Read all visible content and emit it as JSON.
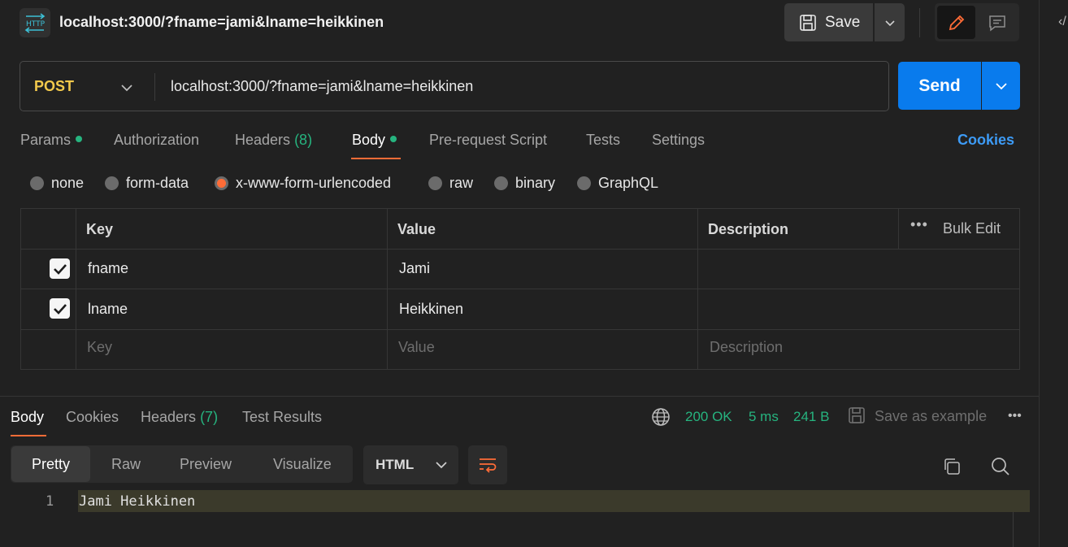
{
  "header": {
    "http_icon_label": "HTTP",
    "request_title": "localhost:3000/?fname=jami&lname=heikkinen",
    "save_label": "Save",
    "rail_glyph": "‹/"
  },
  "request": {
    "method": "POST",
    "url": "localhost:3000/?fname=jami&lname=heikkinen",
    "send_label": "Send"
  },
  "request_tabs": {
    "params": "Params",
    "authorization": "Authorization",
    "headers": "Headers",
    "headers_count": "(8)",
    "body": "Body",
    "pre_request": "Pre-request Script",
    "tests": "Tests",
    "settings": "Settings",
    "cookies": "Cookies"
  },
  "body_types": {
    "none": "none",
    "form_data": "form-data",
    "urlencoded": "x-www-form-urlencoded",
    "raw": "raw",
    "binary": "binary",
    "graphql": "GraphQL",
    "selected": "x-www-form-urlencoded"
  },
  "kv_table": {
    "headers": {
      "key": "Key",
      "value": "Value",
      "description": "Description",
      "bulk_edit": "Bulk Edit",
      "more": "•••"
    },
    "rows": [
      {
        "checked": true,
        "key": "fname",
        "value": "Jami",
        "description": ""
      },
      {
        "checked": true,
        "key": "lname",
        "value": "Heikkinen",
        "description": ""
      }
    ],
    "placeholders": {
      "key": "Key",
      "value": "Value",
      "description": "Description"
    }
  },
  "response": {
    "tabs": {
      "body": "Body",
      "cookies": "Cookies",
      "headers": "Headers",
      "headers_count": "(7)",
      "test_results": "Test Results"
    },
    "status": "200 OK",
    "time": "5 ms",
    "size": "241 B",
    "save_example": "Save as example",
    "more": "•••",
    "view_modes": {
      "pretty": "Pretty",
      "raw": "Raw",
      "preview": "Preview",
      "visualize": "Visualize"
    },
    "language": "HTML",
    "lines": [
      {
        "number": "1",
        "text": "Jami Heikkinen"
      }
    ]
  },
  "colors": {
    "accent_orange": "#ff6c37",
    "send_blue": "#097bed",
    "success_green": "#26b47f",
    "method_yellow": "#f2c94c",
    "link_blue": "#3d9bf6"
  }
}
